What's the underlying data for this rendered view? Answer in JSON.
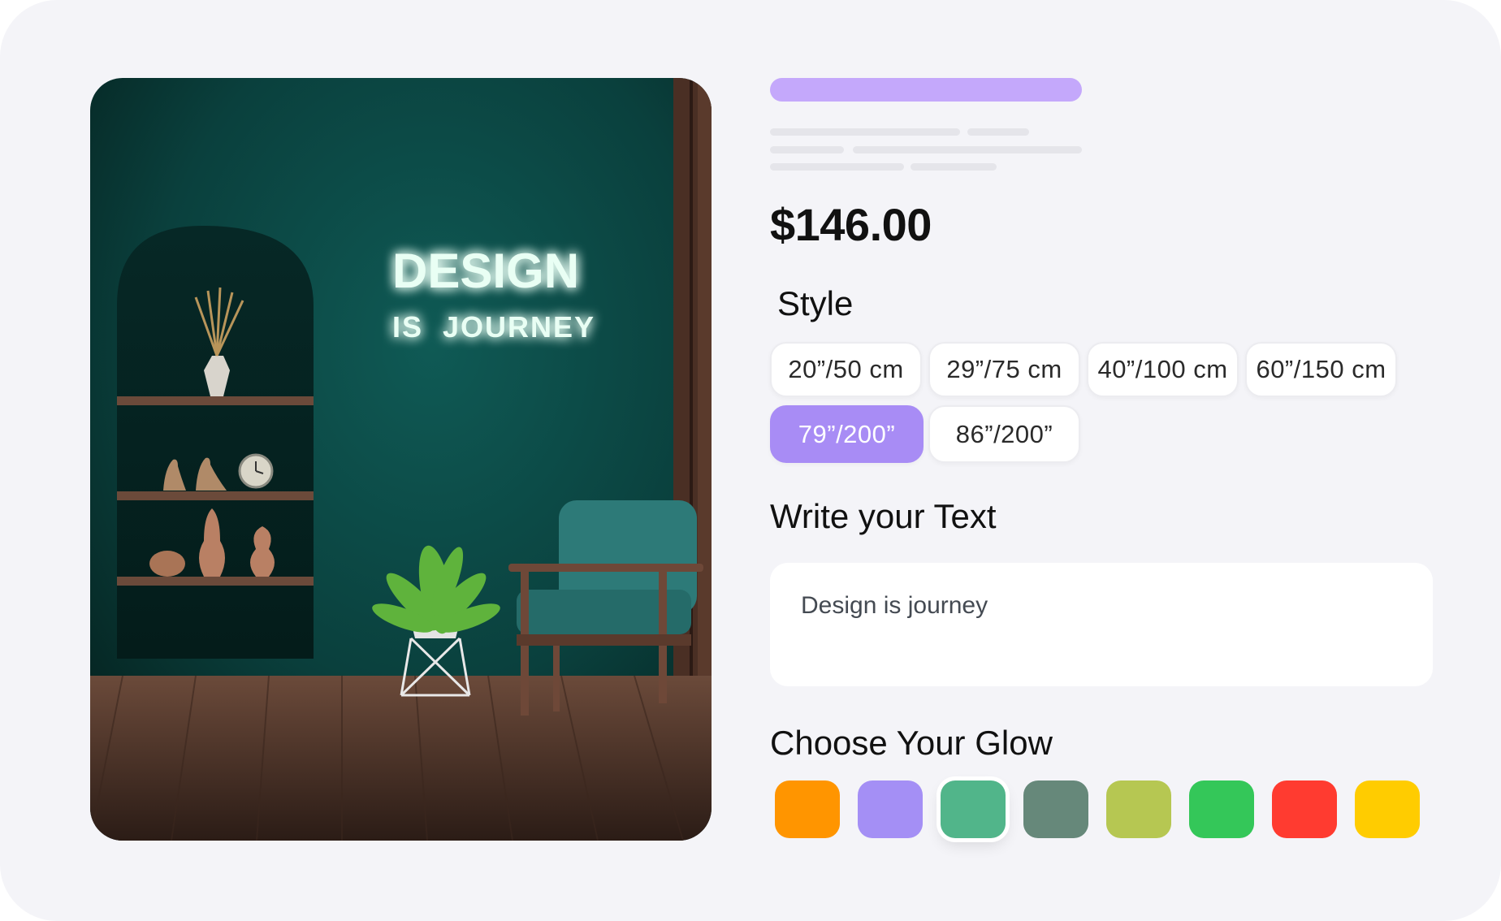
{
  "product": {
    "price": "$146.00",
    "image": {
      "sign_line1": "DESIGN",
      "sign_line2": "IS  JOURNEY"
    }
  },
  "style": {
    "title": "Style",
    "selected": "79”/200”",
    "options": [
      "20”/50 cm",
      "29”/75 cm",
      "40”/100 cm",
      "60”/150 cm",
      "79”/200”",
      "86”/200”"
    ]
  },
  "text": {
    "title": "Write your Text",
    "value": "Design is journey"
  },
  "glow": {
    "title": "Choose Your Glow",
    "selected_index": 2,
    "colors": [
      "#ff9500",
      "#a48ff5",
      "#51b58a",
      "#66887a",
      "#b6c752",
      "#34c759",
      "#ff3b30",
      "#ffcc00"
    ]
  },
  "colors": {
    "accent": "#a88cf5",
    "title_placeholder": "#c4a8fb",
    "skeleton": "#e5e5ea"
  }
}
